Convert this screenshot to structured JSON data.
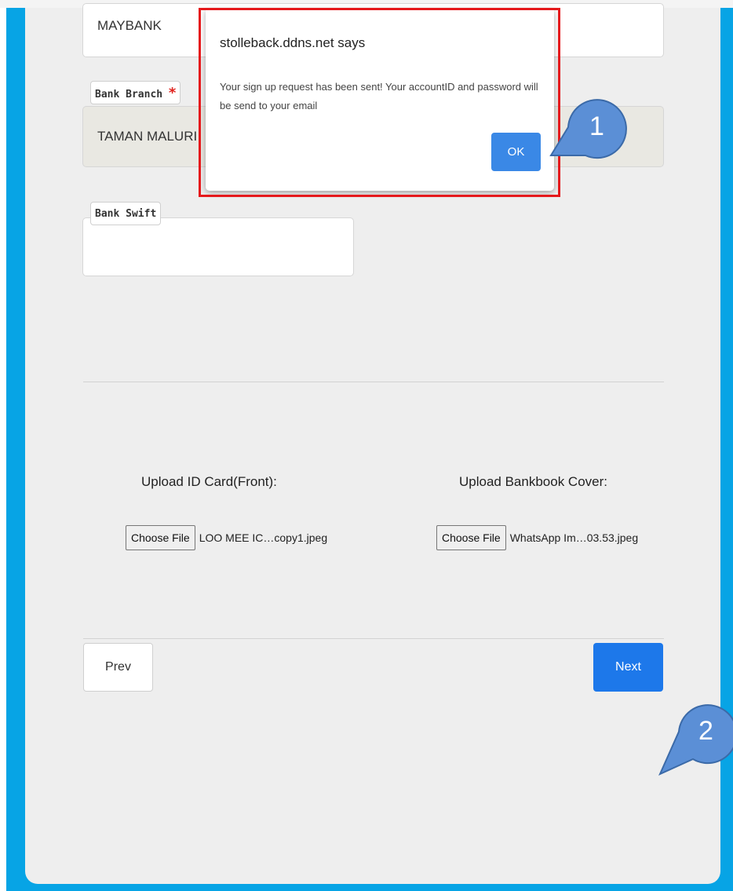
{
  "form": {
    "bank_name_value": "MAYBANK",
    "bank_branch_label": "Bank Branch",
    "bank_branch_required": "*",
    "bank_branch_value": "TAMAN MALURI",
    "bank_swift_label": "Bank Swift",
    "bank_swift_value": ""
  },
  "uploads": {
    "id_card_title": "Upload ID Card(Front):",
    "id_card_button": "Choose File",
    "id_card_filename": "LOO MEE IC…copy1.jpeg",
    "bankbook_title": "Upload Bankbook Cover:",
    "bankbook_button": "Choose File",
    "bankbook_filename": "WhatsApp Im…03.53.jpeg"
  },
  "nav": {
    "prev_label": "Prev",
    "next_label": "Next"
  },
  "alert": {
    "title": "stolleback.ddns.net says",
    "message": "Your sign up request has been sent! Your accountID and password will be send to your email",
    "ok_label": "OK"
  },
  "callouts": {
    "one": "1",
    "two": "2"
  },
  "colors": {
    "frame_blue": "#07a4e5",
    "primary_button": "#1d78ea",
    "highlight_red": "#e5191c",
    "callout_blue": "#5b8fd6",
    "required_red": "#e0221d"
  }
}
